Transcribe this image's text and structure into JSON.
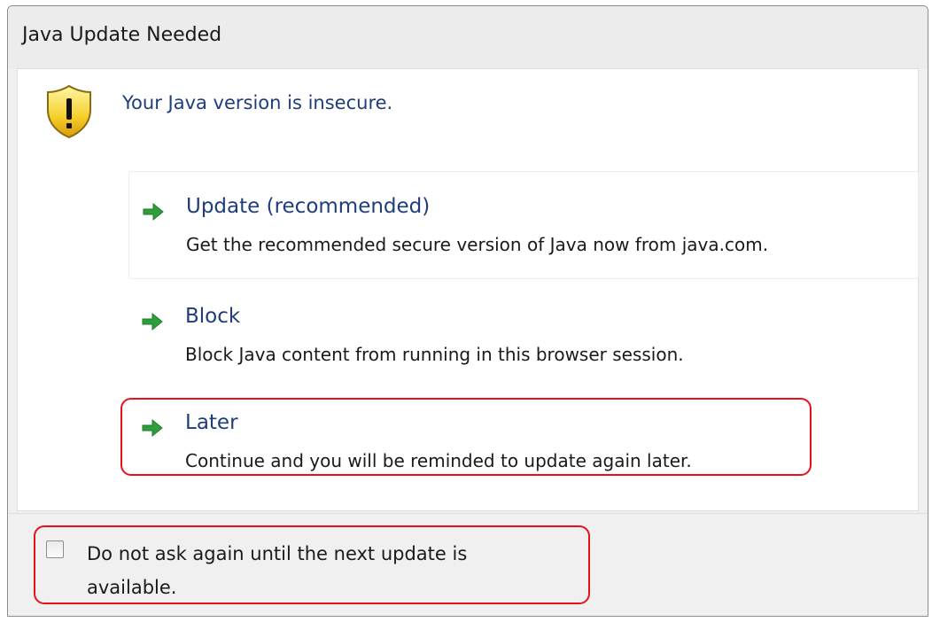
{
  "window": {
    "title": "Java Update Needed"
  },
  "message": {
    "heading": "Your Java version is insecure.",
    "icon": "warning-shield-icon"
  },
  "options": [
    {
      "title": "Update (recommended)",
      "description": "Get the recommended secure version of Java now from java.com."
    },
    {
      "title": "Block",
      "description": "Block Java content from running in this browser session."
    },
    {
      "title": "Later",
      "description": "Continue and you will be reminded to update again later."
    }
  ],
  "footer": {
    "checkbox_label": "Do not ask again until the next update is available.",
    "checked": false
  },
  "colors": {
    "highlight": "#e8101a",
    "link_text": "#1e3d7b",
    "arrow": "#2e9e3a"
  }
}
